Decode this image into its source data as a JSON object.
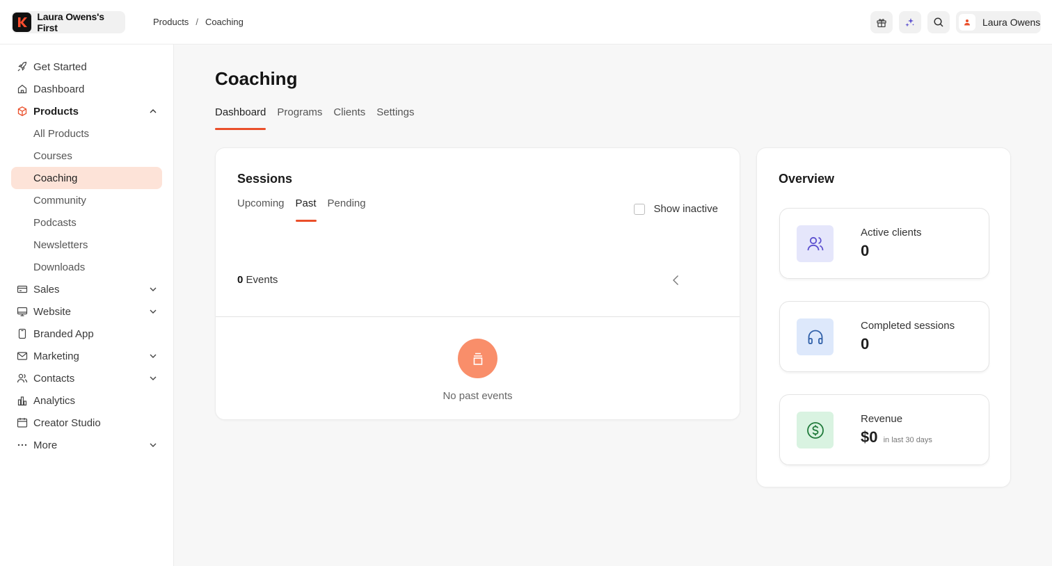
{
  "brand": {
    "name": "Laura Owens's First",
    "logo_icon": "kajabi-logo-icon"
  },
  "breadcrumb": {
    "items": [
      "Products",
      "Coaching"
    ],
    "separator": "/"
  },
  "user": {
    "name": "Laura Owens"
  },
  "topbar_icons": [
    "gift-icon",
    "sparkle-icon",
    "search-icon"
  ],
  "sidebar": {
    "items": [
      {
        "label": "Get Started",
        "icon": "rocket-icon"
      },
      {
        "label": "Dashboard",
        "icon": "home-icon"
      },
      {
        "label": "Products",
        "icon": "box-icon"
      },
      {
        "label": "All Products"
      },
      {
        "label": "Courses"
      },
      {
        "label": "Coaching"
      },
      {
        "label": "Community"
      },
      {
        "label": "Podcasts"
      },
      {
        "label": "Newsletters"
      },
      {
        "label": "Downloads"
      },
      {
        "label": "Sales",
        "icon": "credit-card-icon"
      },
      {
        "label": "Website",
        "icon": "monitor-icon"
      },
      {
        "label": "Branded App",
        "icon": "phone-icon"
      },
      {
        "label": "Marketing",
        "icon": "mail-icon"
      },
      {
        "label": "Contacts",
        "icon": "users-icon"
      },
      {
        "label": "Analytics",
        "icon": "bar-chart-icon"
      },
      {
        "label": "Creator Studio",
        "icon": "calendar-icon"
      },
      {
        "label": "More",
        "icon": "more-icon"
      }
    ]
  },
  "page": {
    "title": "Coaching",
    "tabs": [
      "Dashboard",
      "Programs",
      "Clients",
      "Settings"
    ],
    "active_tab": "Dashboard"
  },
  "sessions": {
    "title": "Sessions",
    "tabs": [
      "Upcoming",
      "Past",
      "Pending"
    ],
    "active_tab": "Past",
    "show_inactive_label": "Show inactive",
    "events_count": "0",
    "events_label": "Events",
    "empty_text": "No past events"
  },
  "overview": {
    "title": "Overview",
    "stats": [
      {
        "label": "Active clients",
        "value": "0",
        "icon": "users-icon",
        "color": "#5b4fcf",
        "bg": "#e5e6fb"
      },
      {
        "label": "Completed sessions",
        "value": "0",
        "icon": "headphones-icon",
        "color": "#2f5fa8",
        "bg": "#dde8fb"
      },
      {
        "label": "Revenue",
        "value": "$0",
        "note": "in last 30 days",
        "icon": "dollar-icon",
        "color": "#1f7a3a",
        "bg": "#d9f3e1"
      }
    ]
  },
  "colors": {
    "accent": "#ea4f2a",
    "active_nav_bg": "#fde3d8",
    "empty_icon_bg": "#f98e6a"
  }
}
